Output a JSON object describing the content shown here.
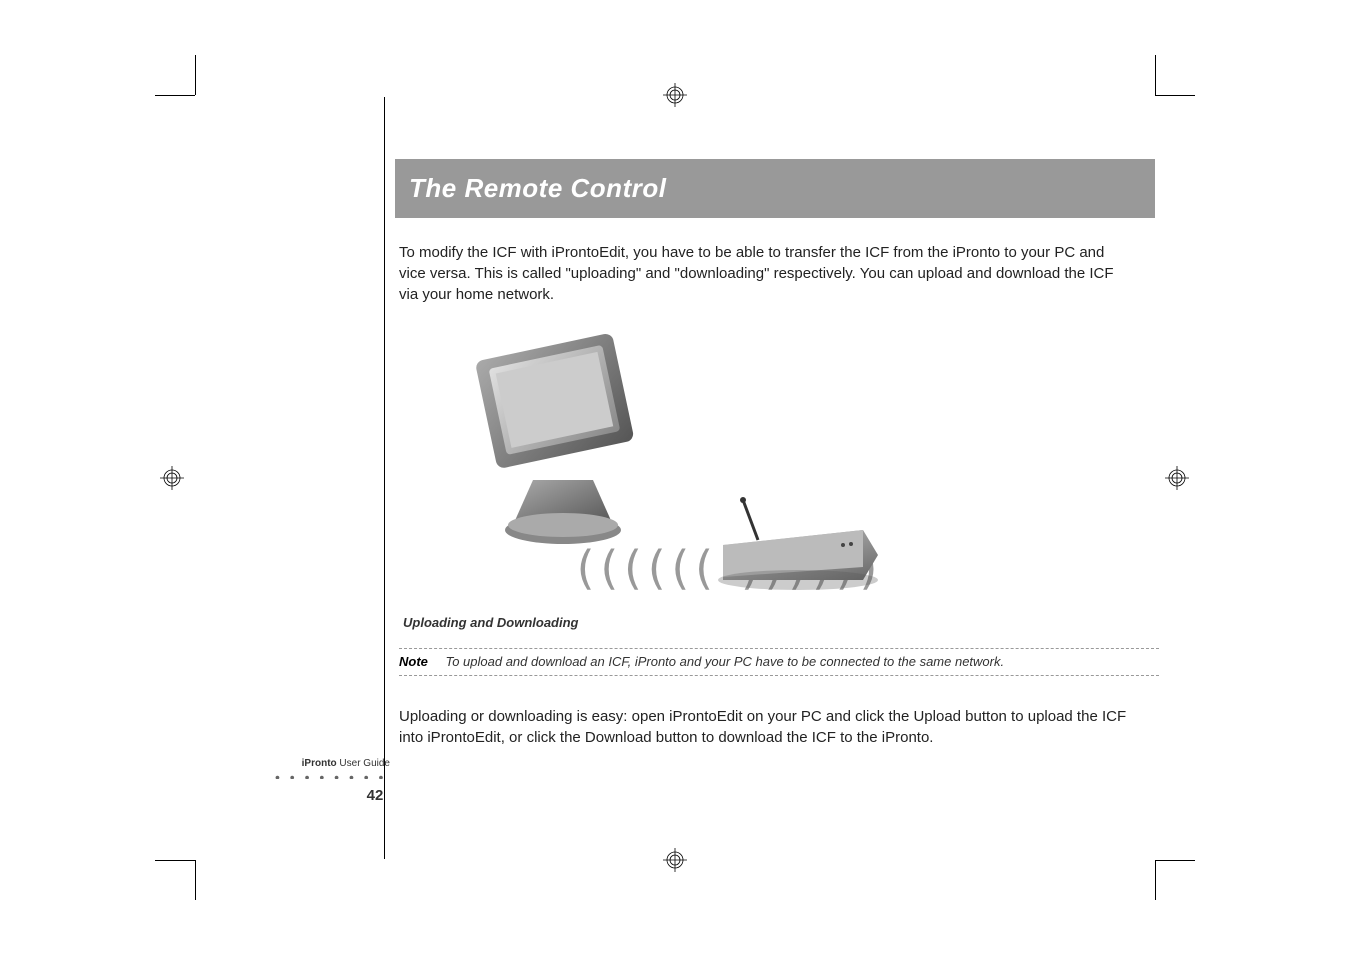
{
  "title": "The Remote Control",
  "body": {
    "paragraph1": "To modify the ICF with iProntoEdit, you have to be able to transfer the ICF from the iPronto to your PC and vice versa. This is called \"uploading\" and \"downloading\" respectively. You can upload and download the ICF via your home network.",
    "paragraph2": "Uploading or downloading is easy: open iProntoEdit on your PC and click the Upload button to upload the ICF into iProntoEdit, or click the Download button to download the ICF to the iPronto."
  },
  "image": {
    "caption": "Uploading and Downloading",
    "wifi_symbol": "(((((( ))))))"
  },
  "note": {
    "label": "Note",
    "text": "To upload and download an ICF, iPronto and your PC have to be connected to the same network."
  },
  "footer": {
    "product": "iPronto",
    "guide": " User Guide",
    "page_number": "42",
    "dots": "• • • • • • • • • • • • • • • • • • • • • •"
  }
}
